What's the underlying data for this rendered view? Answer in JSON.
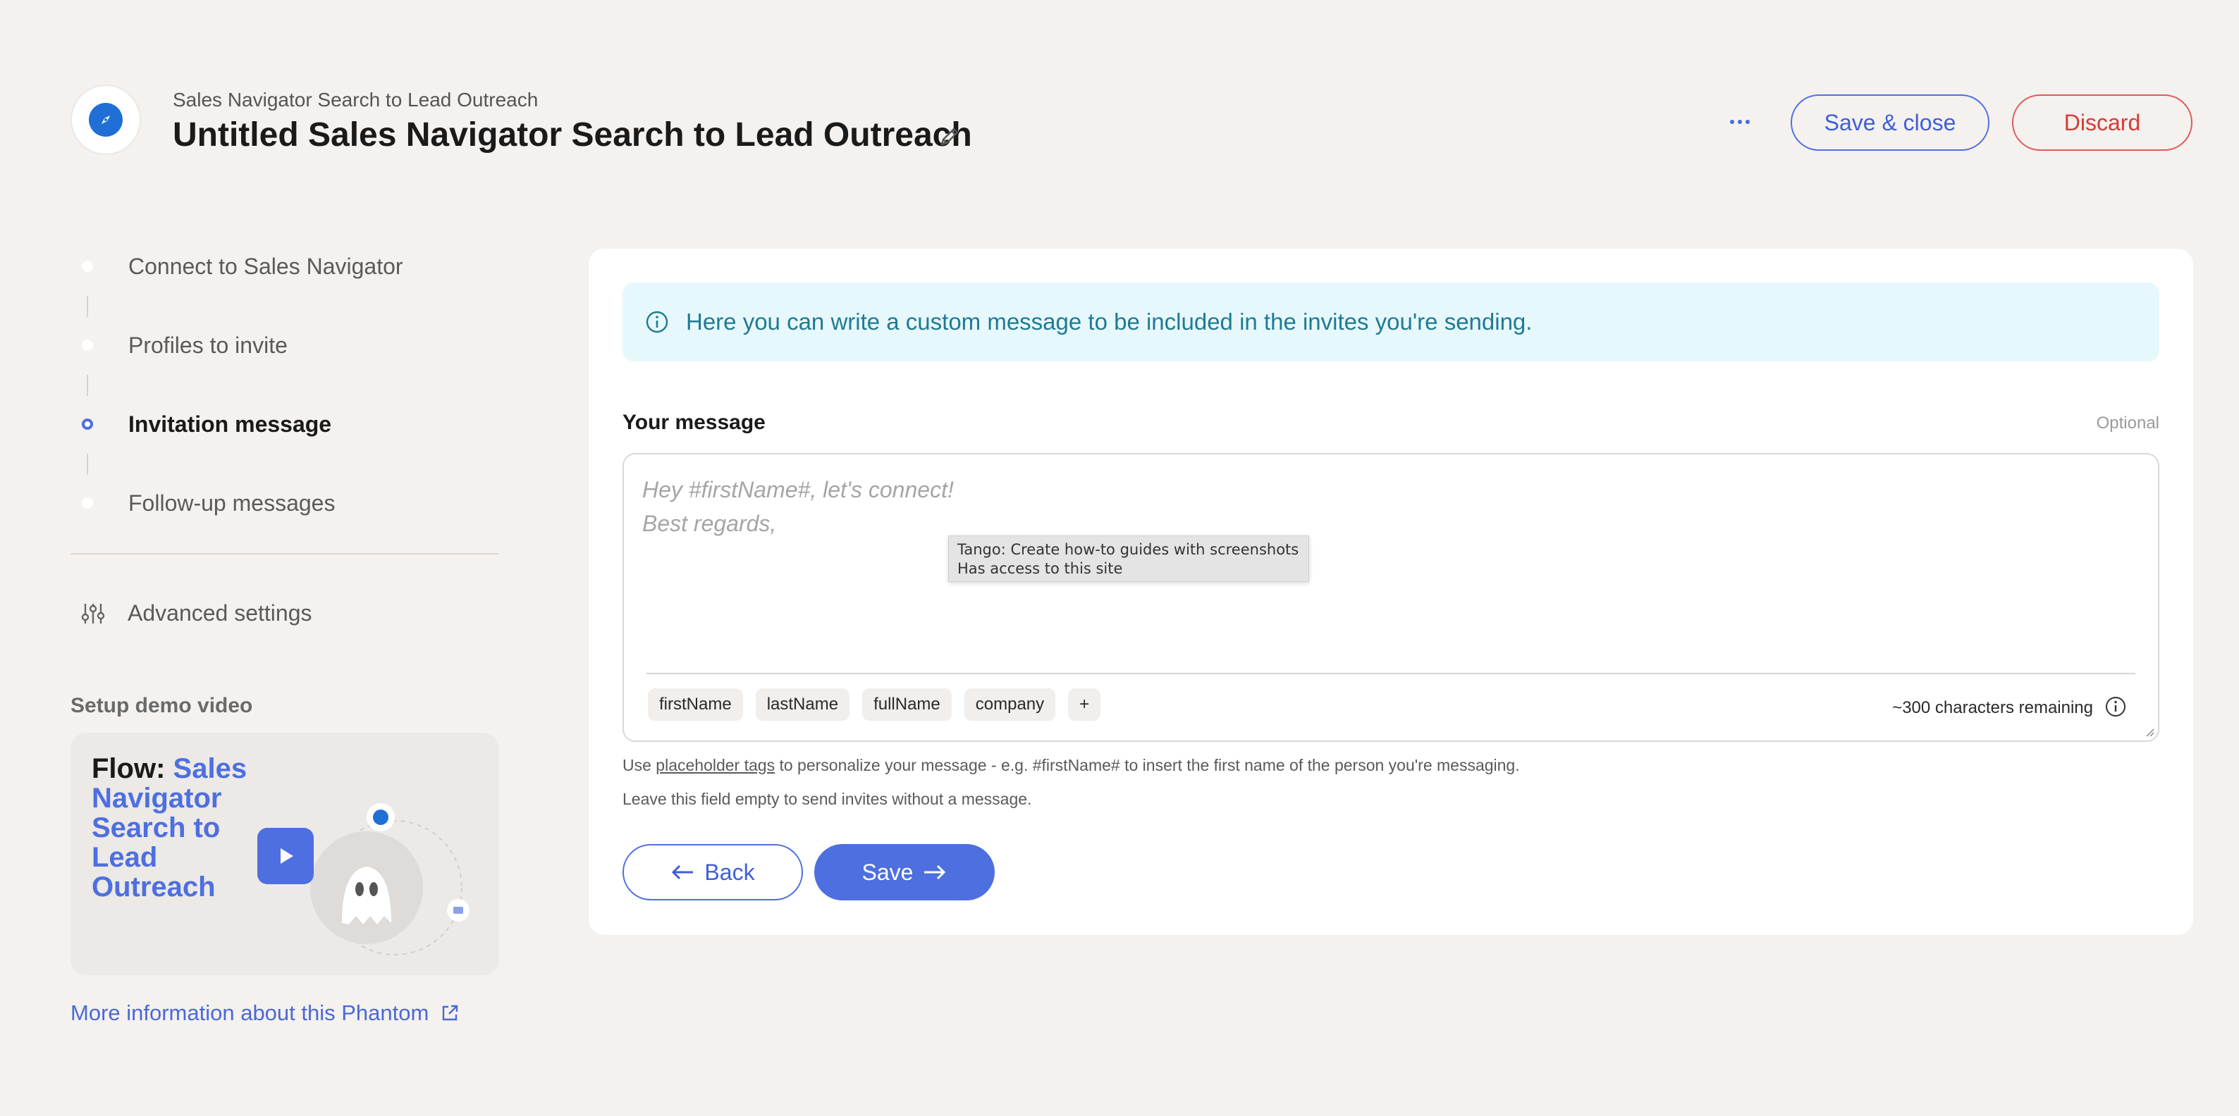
{
  "header": {
    "subtitle": "Sales Navigator Search to Lead Outreach",
    "title": "Untitled Sales Navigator Search to Lead Outreach",
    "save_close_label": "Save & close",
    "discard_label": "Discard"
  },
  "sidebar": {
    "steps": [
      {
        "label": "Connect to Sales Navigator",
        "active": false
      },
      {
        "label": "Profiles to invite",
        "active": false
      },
      {
        "label": "Invitation message",
        "active": true
      },
      {
        "label": "Follow-up messages",
        "active": false
      }
    ],
    "advanced_settings_label": "Advanced settings",
    "demo_title": "Setup demo video",
    "demo_card": {
      "prefix": "Flow:",
      "accent": "Sales Navigator Search to Lead Outreach"
    },
    "more_info_label": "More information about this Phantom"
  },
  "main": {
    "info_banner": "Here you can write a custom message to be included in the invites you're sending.",
    "field_label": "Your message",
    "field_optional": "Optional",
    "message_placeholder": "Hey #firstName#, let's connect!\nBest regards,",
    "tags": [
      "firstName",
      "lastName",
      "fullName",
      "company",
      "+"
    ],
    "chars_remaining": "~300 characters remaining",
    "help_prefix": "Use ",
    "help_link": "placeholder tags",
    "help_suffix": " to personalize your message - e.g. #firstName# to insert the first name of the person you're messaging.",
    "help_line2": "Leave this field empty to send invites without a message.",
    "back_label": "Back",
    "save_label": "Save"
  },
  "tooltip": {
    "line1": "Tango: Create how-to guides with screenshots",
    "line2": "Has access to this site"
  },
  "colors": {
    "accent": "#4d6fe0",
    "discard": "#d63b36",
    "banner_bg": "#e7f8fd",
    "banner_text": "#1d7b93",
    "background": "#f4f1ef"
  }
}
